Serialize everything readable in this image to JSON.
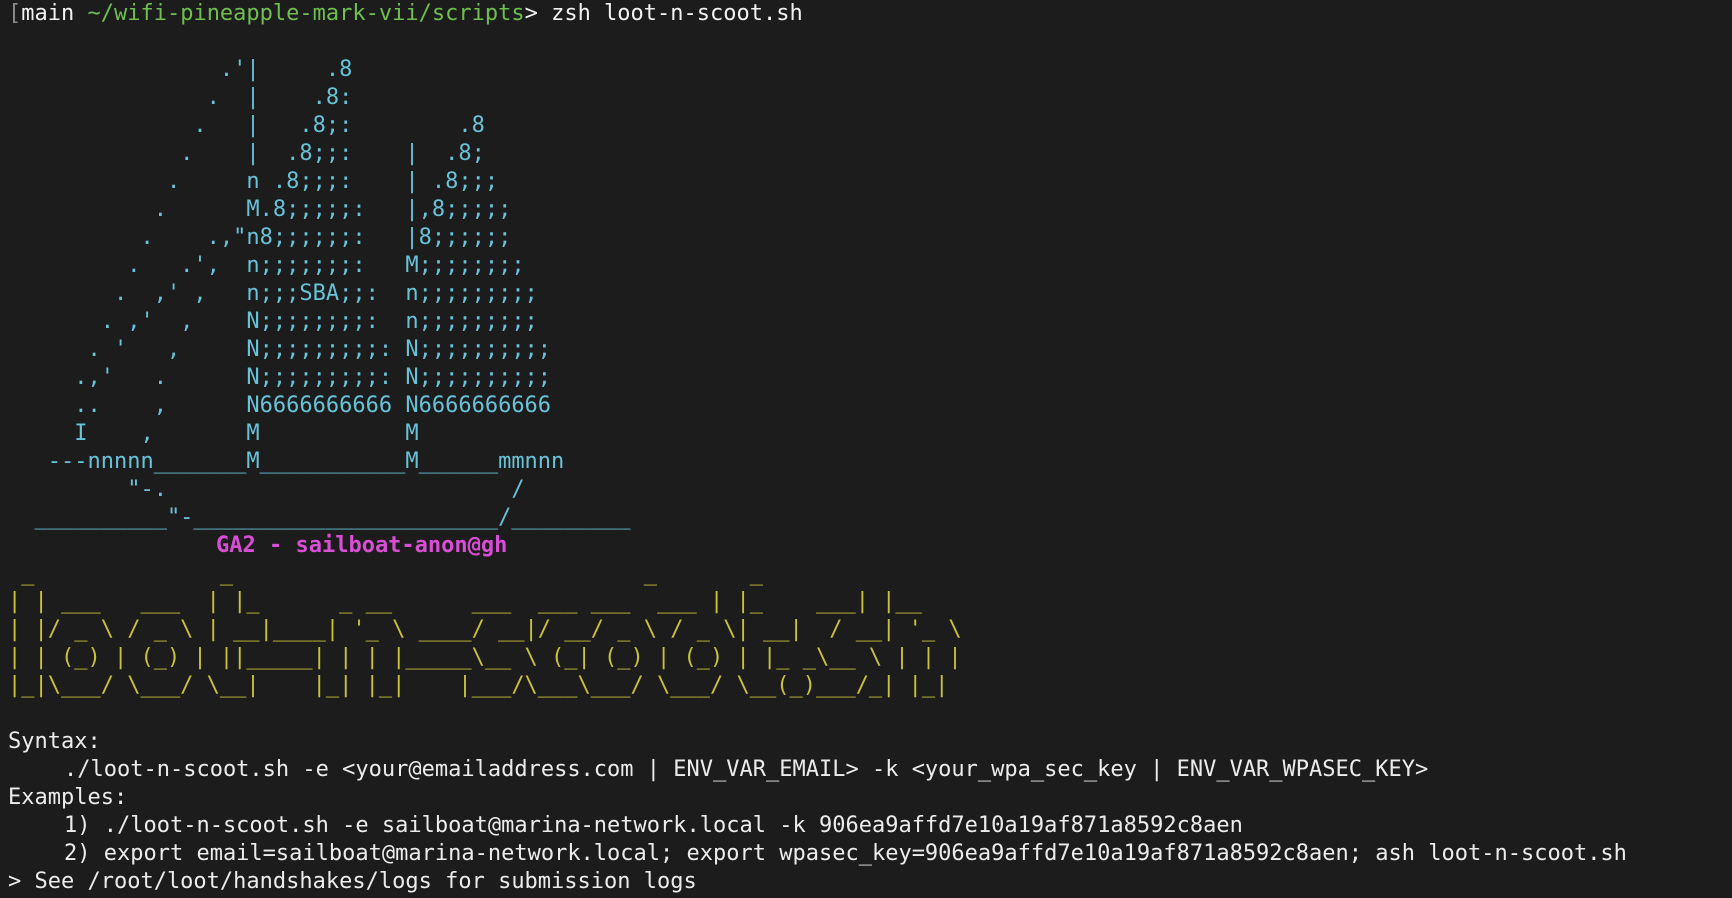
{
  "terminal": {
    "prompt": {
      "bracket": "[",
      "branch": "main",
      "path": "~/wifi-pineapple-mark-vii/scripts",
      "caret": ">",
      "command": "zsh loot-n-scoot.sh"
    },
    "boat_art": "                .'|     .8\n               .  |    .8:\n              .   |   .8;:        .8\n             .    |  .8;;:    |  .8;\n            .     n .8;;;:    | .8;;;\n           .      M.8;;;;;:   |,8;;;;;\n          .    .,\"n8;;;;;;:   |8;;;;;;\n         .   .',  n;;;;;;;:   M;;;;;;;;\n        .  ,' ,   n;;;SBA;;:  n;;;;;;;;;\n       . ,'  ,    N;;;;;;;;:  n;;;;;;;;;\n      . '   ,     N;;;;;;;;;: N;;;;;;;;;;\n     .,'   .      N;;;;;;;;;: N;;;;;;;;;;\n     ..    ,      N6666666666 N6666666666\n     I    ,       M           M\n   ---nnnnn_______M___________M______mmnnn\n         \"-.                          /\n  __________\"-_______________________/_________",
    "credit": "GA2 - sailboat-anon@gh",
    "banner_art": " _              _                               _       _\n| | ___   ___  | |_      _ __      ___  ___ ___  ___ | |_    ___| |__\n| |/ _ \\ / _ \\ | __|____| '_ \\ ____/ __|/ __/ _ \\ / _ \\| __|  / __| '_ \\\n| | (_) | (_) | ||_____| | | |_____\\__ \\ (_| (_) | (_) | |_ _\\__ \\ | | |\n|_|\\___/ \\___/ \\__|    |_| |_|    |___/\\___\\___/ \\___/ \\__(_)___/_| |_|",
    "syntax_label": "Syntax:",
    "syntax_line": "./loot-n-scoot.sh -e <your@emailaddress.com | ENV_VAR_EMAIL> -k <your_wpa_sec_key | ENV_VAR_WPASEC_KEY>",
    "examples_label": "Examples:",
    "example_1": "1) ./loot-n-scoot.sh -e sailboat@marina-network.local -k 906ea9affd7e10a19af871a8592c8aen",
    "example_2": "2) export email=sailboat@marina-network.local; export wpasec_key=906ea9affd7e10a19af871a8592c8aen; ash loot-n-scoot.sh",
    "footer": "> See /root/loot/handshakes/logs for submission logs"
  },
  "colors": {
    "background": "#1c1c1c",
    "path": "#6fbf4f",
    "boat": "#69c3d8",
    "credit": "#d84fd6",
    "banner": "#c9c23a",
    "text": "#f2f2f2"
  }
}
